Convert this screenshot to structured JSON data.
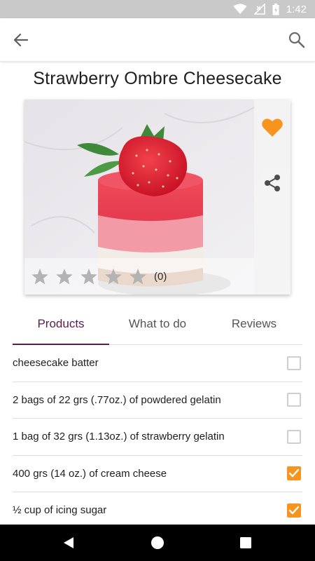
{
  "status_bar": {
    "time": "1:42"
  },
  "recipe": {
    "title": "Strawberry Ombre Cheesecake"
  },
  "rating": {
    "stars": 0,
    "max_stars": 5,
    "count_label": "(0)"
  },
  "favorite": {
    "active": true,
    "color": "#f7941d"
  },
  "tabs": [
    {
      "label": "Products",
      "active": true
    },
    {
      "label": "What to do",
      "active": false
    },
    {
      "label": "Reviews",
      "active": false
    }
  ],
  "ingredients": [
    {
      "label": "cheesecake batter",
      "checked": false
    },
    {
      "label": "2 bags of 22 grs (.77oz.) of powdered gelatin",
      "checked": false
    },
    {
      "label": "1 bag of 32 grs (1.13oz.) of strawberry gelatin",
      "checked": false
    },
    {
      "label": "400 grs (14 oz.) of cream cheese",
      "checked": true
    },
    {
      "label": "½ cup of icing sugar",
      "checked": true
    }
  ],
  "colors": {
    "accent": "#f7941d",
    "tab_active": "#5a1b4f"
  }
}
